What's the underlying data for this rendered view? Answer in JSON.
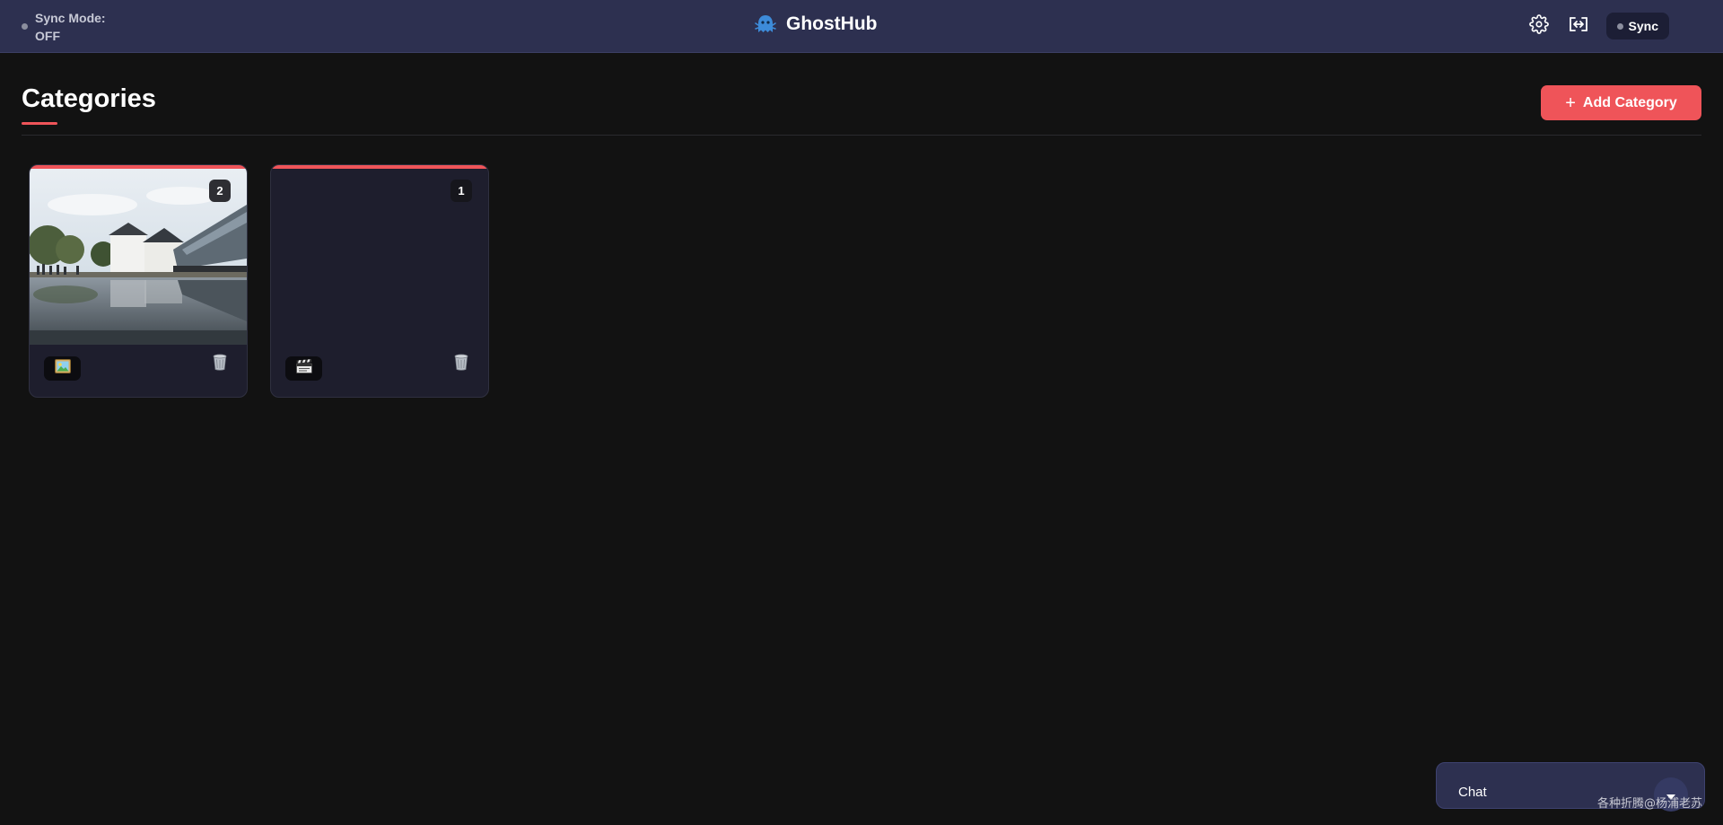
{
  "header": {
    "sync_mode": {
      "label": "Sync Mode:",
      "value": "OFF"
    },
    "app_name": "GhostHub",
    "sync_button_label": "Sync"
  },
  "main": {
    "title": "Categories",
    "add_button_label": "Add Category"
  },
  "categories": [
    {
      "count": "2",
      "media_type_icon": "picture-icon",
      "has_thumbnail": true
    },
    {
      "count": "1",
      "media_type_icon": "clapperboard-icon",
      "has_thumbnail": false
    }
  ],
  "chat": {
    "label": "Chat"
  },
  "watermark": "各种折腾@杨浦老苏",
  "colors": {
    "header_bg": "#2d3050",
    "page_bg": "#121212",
    "accent": "#ef5459",
    "card_bg": "#1e1e2d"
  }
}
